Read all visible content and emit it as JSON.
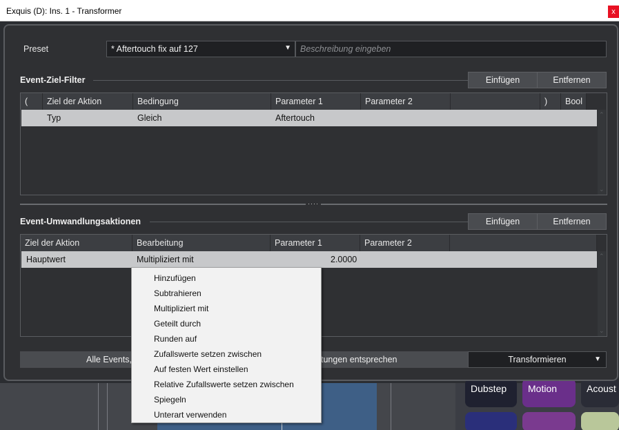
{
  "window": {
    "title": "Exquis (D): Ins. 1 - Transformer",
    "close_label": "x"
  },
  "preset": {
    "label": "Preset",
    "value": "* Aftertouch fix auf 127",
    "description_placeholder": "Beschreibung eingeben"
  },
  "filter": {
    "title": "Event-Ziel-Filter",
    "insert_label": "Einfügen",
    "remove_label": "Entfernen",
    "columns": [
      "(",
      "Ziel der Aktion",
      "Bedingung",
      "Parameter 1",
      "Parameter 2",
      "",
      ")",
      "Bool"
    ],
    "rows": [
      {
        "target": "Typ",
        "condition": "Gleich",
        "param1": "Aftertouch"
      }
    ]
  },
  "actions": {
    "title": "Event-Umwandlungsaktionen",
    "insert_label": "Einfügen",
    "remove_label": "Entfernen",
    "columns": [
      "Ziel der Aktion",
      "Bearbeitung",
      "Parameter 1",
      "Parameter 2",
      ""
    ],
    "rows": [
      {
        "target": "Hauptwert",
        "operation": "Multipliziert mit",
        "param1": "2.0000"
      }
    ]
  },
  "bottom": {
    "scope_left": "Alle Events,",
    "scope_right": "tungen entsprechen",
    "mode_value": "Transformieren"
  },
  "context_menu": {
    "items": [
      "Hinzufügen",
      "Subtrahieren",
      "Multipliziert mit",
      "Geteilt durch",
      "Runden auf",
      "Zufallswerte setzen zwischen",
      "Auf festen Wert einstellen",
      "Relative Zufallswerte setzen zwischen",
      "Spiegeln",
      "Unterart verwenden"
    ]
  },
  "background": {
    "tiles": [
      "Dubstep",
      "Motion",
      "Acoust"
    ]
  },
  "colors": {
    "dialog_bg": "#2f3033",
    "row_selected": "#c7c8ca",
    "close_red": "#e81123",
    "menu_bg": "#f2f2f2"
  },
  "icons": {
    "dropdown": "chevron-down-icon",
    "close": "close-icon",
    "splitter": "drag-handle-icon"
  }
}
